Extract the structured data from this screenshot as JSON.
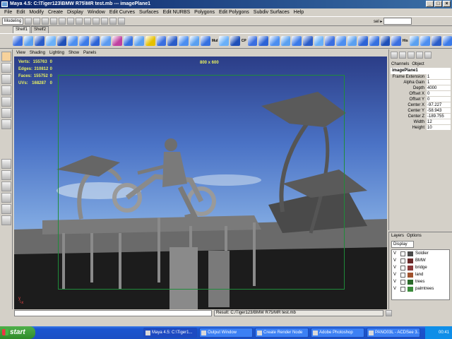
{
  "window": {
    "title": "Maya 4.5: C:\\Tiger123\\BMW R75\\MR test.mb   ---   imagePlane1",
    "buttons": [
      "_",
      "□",
      "×"
    ]
  },
  "menubar": [
    "File",
    "Edit",
    "Modify",
    "Create",
    "Display",
    "Window",
    "Edit Curves",
    "Surfaces",
    "Edit NURBS",
    "Polygons",
    "Edit Polygons",
    "Subdiv Surfaces",
    "Help"
  ],
  "statusline": {
    "mode": "Modeling",
    "sel_label": "sel ▸"
  },
  "shelf": {
    "tabs": [
      "Shelf1",
      "Shelf2"
    ],
    "colors": [
      "#3a6ee0",
      "#5aa0f0",
      "#2a5cc8",
      "#6ab0f8",
      "#1e4fb8",
      "#4c8ef0",
      "#3b7ae8",
      "#2c63d6",
      "#5a9af0",
      "#c040a0",
      "#3570e0",
      "#5aa0f0",
      "#e6c000",
      "#3a6ee0",
      "#2a5cc8",
      "#4c8ef0",
      "#5aa0f0",
      "#3570e0",
      "#6ab0f8",
      "#1e4fb8",
      "#3a6ee0",
      "#2c63d6",
      "#4c8ef0",
      "#5aa0f0",
      "#3b7ae8",
      "#2a5cc8",
      "#6ab0f8",
      "#3a6ee0",
      "#4c8ef0",
      "#5aa0f0",
      "#2c63d6",
      "#3570e0",
      "#1e4fb8",
      "#3a6ee0",
      "#5aa0f0",
      "#4c8ef0",
      "#2a5cc8",
      "#3b7ae8"
    ],
    "shortcut_labels": [
      "Mul",
      "CP",
      "His"
    ]
  },
  "panel_menu": [
    "View",
    "Shading",
    "Lighting",
    "Show",
    "Panels"
  ],
  "hud": {
    "stats": [
      {
        "label": "Verts:",
        "value": "155763",
        "sel": "0"
      },
      {
        "label": "Edges:",
        "value": "310812",
        "sel": "0"
      },
      {
        "label": "Faces:",
        "value": "155752",
        "sel": "0"
      },
      {
        "label": "UVs:",
        "value": "168287",
        "sel": "0"
      }
    ],
    "resolution": "800 x 600"
  },
  "channel_box": {
    "tabs": [
      "Channels",
      "Object"
    ],
    "object": "imagePlane1",
    "attributes": [
      {
        "name": "Frame Extension",
        "value": "1"
      },
      {
        "name": "Alpha Gain",
        "value": "1"
      },
      {
        "name": "Depth",
        "value": "4000"
      },
      {
        "name": "Offset X",
        "value": "0"
      },
      {
        "name": "Offset Y",
        "value": "0"
      },
      {
        "name": "Center X",
        "value": "-97.227"
      },
      {
        "name": "Center Y",
        "value": "-58.943"
      },
      {
        "name": "Center Z",
        "value": "-189.755"
      },
      {
        "name": "Width",
        "value": "12"
      },
      {
        "name": "Height",
        "value": "10"
      }
    ]
  },
  "layers": {
    "tabs": [
      "Layers",
      "Options"
    ],
    "dropdown": "Display",
    "items": [
      {
        "v": "V",
        "name": "Soldier",
        "color": "#4a4a4a"
      },
      {
        "v": "V",
        "name": "BMW",
        "color": "#6a2a2a"
      },
      {
        "v": "V",
        "name": "bridge",
        "color": "#8a3a3a"
      },
      {
        "v": "V",
        "name": "land",
        "color": "#a0522d"
      },
      {
        "v": "V",
        "name": "trees",
        "color": "#2a6a2a"
      },
      {
        "v": "V",
        "name": "palmtrees",
        "color": "#3a8a3a"
      }
    ]
  },
  "helpline": {
    "result": "Result: C:/Tiger123/BMW R75/MR test.mb"
  },
  "taskbar": {
    "start": "start",
    "tasks": [
      {
        "label": "Maya 4.5: C:\\Tiger1...",
        "active": true
      },
      {
        "label": "Output Window",
        "active": false
      },
      {
        "label": "Create Render Node",
        "active": false
      },
      {
        "label": "Adobe Photoshop",
        "active": false
      },
      {
        "label": "PANO03L - ACDSee 3...",
        "active": false
      }
    ],
    "clock": "00:41"
  }
}
